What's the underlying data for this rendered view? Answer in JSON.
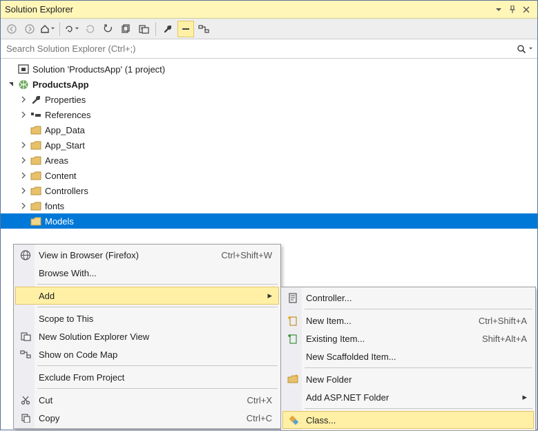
{
  "title": "Solution Explorer",
  "search": {
    "placeholder": "Search Solution Explorer (Ctrl+;)"
  },
  "tree": {
    "solution": "Solution 'ProductsApp' (1 project)",
    "project": "ProductsApp",
    "items": [
      "Properties",
      "References",
      "App_Data",
      "App_Start",
      "Areas",
      "Content",
      "Controllers",
      "fonts",
      "Models"
    ]
  },
  "menu1": {
    "view_browser": "View in Browser (Firefox)",
    "view_browser_short": "Ctrl+Shift+W",
    "browse_with": "Browse With...",
    "add": "Add",
    "scope": "Scope to This",
    "new_view": "New Solution Explorer View",
    "codemap": "Show on Code Map",
    "exclude": "Exclude From Project",
    "cut": "Cut",
    "cut_short": "Ctrl+X",
    "copy": "Copy",
    "copy_short": "Ctrl+C"
  },
  "menu2": {
    "controller": "Controller...",
    "new_item": "New Item...",
    "new_item_short": "Ctrl+Shift+A",
    "existing_item": "Existing Item...",
    "existing_item_short": "Shift+Alt+A",
    "scaffold": "New Scaffolded Item...",
    "new_folder": "New Folder",
    "aspnet_folder": "Add ASP.NET Folder",
    "class": "Class..."
  }
}
